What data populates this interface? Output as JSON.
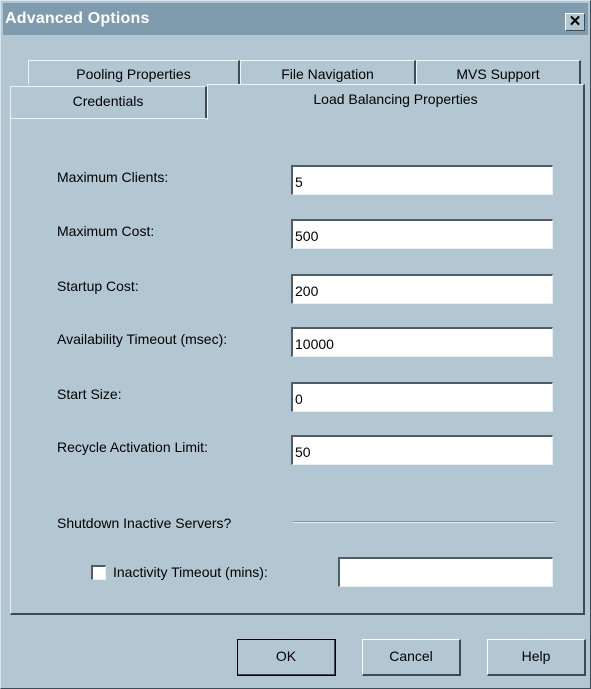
{
  "window": {
    "title": "Advanced Options",
    "close_glyph": "✕"
  },
  "tabs": {
    "back_row": [
      {
        "label": "Pooling Properties"
      },
      {
        "label": "File Navigation"
      },
      {
        "label": "MVS Support"
      }
    ],
    "front_row": [
      {
        "label": "Credentials"
      },
      {
        "label": "Load Balancing Properties",
        "active": true
      }
    ]
  },
  "fields": [
    {
      "label": "Maximum Clients:",
      "value": "5"
    },
    {
      "label": "Maximum Cost:",
      "value": "500"
    },
    {
      "label": "Startup Cost:",
      "value": "200"
    },
    {
      "label": "Availability Timeout (msec):",
      "value": "10000"
    },
    {
      "label": "Start Size:",
      "value": "0"
    },
    {
      "label": "Recycle Activation Limit:",
      "value": "50"
    }
  ],
  "shutdown": {
    "group_label": "Shutdown Inactive Servers?",
    "checkbox_label": "Inactivity Timeout (mins):",
    "checked": false,
    "timeout_value": ""
  },
  "buttons": {
    "ok": "OK",
    "cancel": "Cancel",
    "help": "Help"
  },
  "colors": {
    "background": "#b3c7d3",
    "titlebar": "#7e9cae",
    "title_text": "#ffffff"
  },
  "icons": {
    "close": "close-icon",
    "checkbox": "checkbox-unchecked-icon"
  }
}
